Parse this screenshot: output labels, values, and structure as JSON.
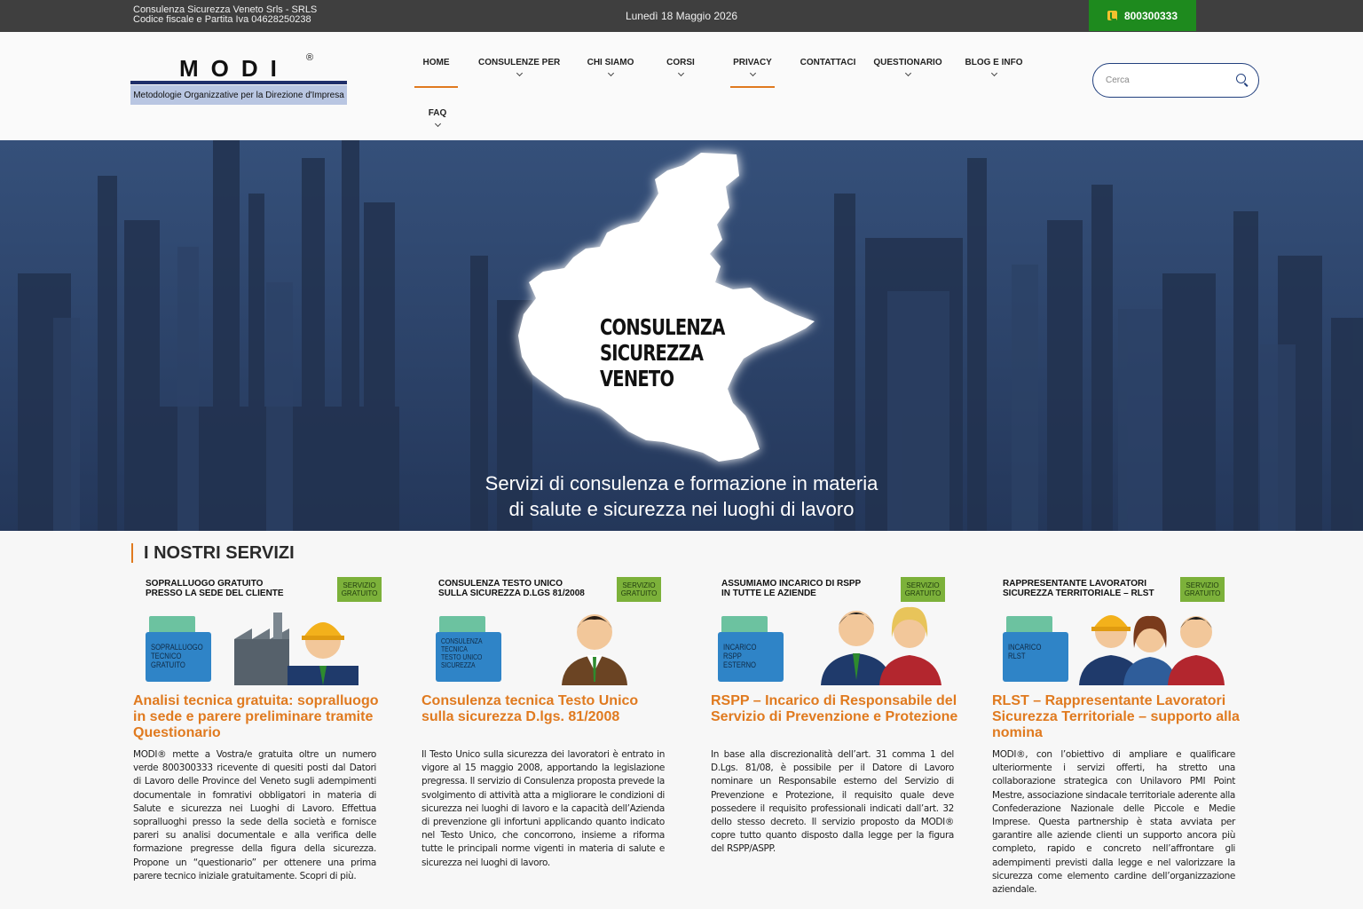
{
  "topbar": {
    "company_line1": "Consulenza Sicurezza Veneto Srls - SRLS",
    "company_line2": "Codice fiscale e Partita Iva 04628250238",
    "date": "Lunedì 18 Maggio 2026",
    "phone": "800300333",
    "phone_bg": "#1e8a1e"
  },
  "logo": {
    "letters": "MODI",
    "registered": "®",
    "tagline": "Metodologie Organizzative per la Direzione d'Impresa"
  },
  "nav": {
    "items": [
      {
        "label": "HOME",
        "dropdown": false,
        "active": true
      },
      {
        "label": "CONSULENZE PER",
        "dropdown": true,
        "active": false
      },
      {
        "label": "CHI SIAMO",
        "dropdown": true,
        "active": false
      },
      {
        "label": "CORSI",
        "dropdown": true,
        "active": false
      },
      {
        "label": "PRIVACY",
        "dropdown": true,
        "active": true
      },
      {
        "label": "CONTATTACI",
        "dropdown": false,
        "active": false
      },
      {
        "label": "QUESTIONARIO",
        "dropdown": true,
        "active": false
      },
      {
        "label": "BLOG E INFO",
        "dropdown": true,
        "active": false
      },
      {
        "label": "FAQ",
        "dropdown": true,
        "active": false
      }
    ],
    "accent": "#e07a1f"
  },
  "search": {
    "placeholder": "Cerca",
    "icon": "search-icon"
  },
  "hero": {
    "map_title_lines": [
      "CONSULENZA",
      "SICUREZZA",
      "VENETO"
    ],
    "caption_line1": "Servizi di consulenza e formazione in materia",
    "caption_line2": "di salute e sicurezza nei luoghi di lavoro"
  },
  "services": {
    "title": "I NOSTRI SERVIZI",
    "cards": [
      {
        "header": "SOPRALLUOGO GRATUITO\nPRESSO LA SEDE DEL CLIENTE",
        "badge": "SERVIZIO\nGRATUITO",
        "folder_text": "SOPRALLUOGO\nTECNICO\nGRATUITO",
        "title": "Analisi tecnica gratuita: sopralluogo in sede e parere preliminare tramite Questionario",
        "body": "MODI® mette a Vostra/e gratuita oltre un numero verde 800300333 ricevente di quesiti posti dal Datori di Lavoro delle Province del Veneto sugli adempimenti documentale in fomrativi obbligatori in materia di Salute e sicurezza nei Luoghi di Lavoro. Effettua sopralluoghi presso la sede della società e fornisce pareri su analisi documentale e alla verifica delle formazione pregresse della figura della sicurezza. Propone un “questionario” per ottenere una prima parere tecnico iniziale gratuitamente. Scopri di più."
      },
      {
        "header": "CONSULENZA TESTO UNICO\nSULLA SICUREZZA D.LGS 81/2008",
        "badge": "SERVIZIO\nGRATUITO",
        "folder_text": "CONSULENZA\nTECNICA\nTESTO UNICO\nSICUREZZA",
        "title": "Consulenza tecnica Testo Unico sulla sicurezza D.lgs. 81/2008",
        "body": "Il Testo Unico sulla sicurezza dei lavoratori è entrato in vigore al 15 maggio 2008, apportando la legislazione pregressa. Il servizio di Consulenza proposta prevede la svolgimento di attività atta a migliorare le condizioni di sicurezza nei luoghi di lavoro e la capacità dell’Azienda di prevenzione gli infortuni applicando quanto indicato nel Testo Unico, che concorrono, insieme a riforma tutte le principali norme vigenti in materia di salute e sicurezza nei luoghi di lavoro."
      },
      {
        "header": "ASSUMIAMO INCARICO DI RSPP\nIN TUTTE LE AZIENDE",
        "badge": "SERVIZIO\nGRATUITO",
        "folder_text": "INCARICO\nRSPP\nESTERNO",
        "title": "RSPP – Incarico di Responsabile del Servizio di Prevenzione e Protezione",
        "body": "In base alla discrezionalità dell’art. 31 comma 1 del D.Lgs. 81/08, è possibile per il Datore di Lavoro nominare un Responsabile esterno del Servizio di Prevenzione e Protezione, il requisito quale deve possedere il requisito professionali indicati dall’art. 32 dello stesso decreto. Il servizio proposto da MODI® copre tutto quanto disposto dalla legge per la figura del RSPP/ASPP."
      },
      {
        "header": "RAPPRESENTANTE LAVORATORI\nSICUREZZA TERRITORIALE – RLST",
        "badge": "SERVIZIO\nGRATUITO",
        "folder_text": "INCARICO\nRLST",
        "title": "RLST – Rappresentante Lavoratori Sicurezza Territoriale – supporto alla nomina",
        "body": "MODI®, con l’obiettivo di ampliare e qualificare ulteriormente i servizi offerti, ha stretto una collaborazione strategica con Unilavoro PMI Point Mestre, associazione sindacale territoriale aderente alla Confederazione Nazionale delle Piccole e Medie Imprese. Questa partnership è stata avviata per garantire alle aziende clienti un supporto ancora più completo, rapido e concreto nell’affrontare gli adempimenti previsti dalla legge e nel valorizzare la sicurezza come elemento cardine dell’organizzazione aziendale."
      }
    ]
  }
}
